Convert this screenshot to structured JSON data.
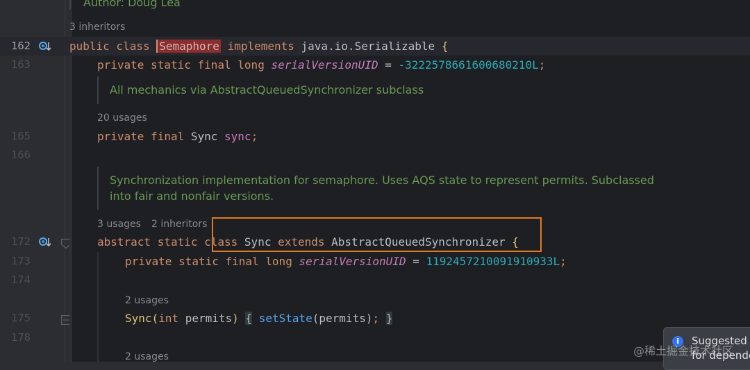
{
  "author_line": "Author: Doug Lea",
  "hints": {
    "class_inheritors": "3 inheritors",
    "sync_field_usages": "20 usages",
    "sync_class_usages": "3 usages",
    "sync_class_inheritors": "2 inheritors",
    "ctor_usages": "2 usages",
    "last_usages": "2 usages"
  },
  "line_numbers": [
    "162",
    "163",
    "165",
    "166",
    "172",
    "173",
    "174",
    "175",
    "178"
  ],
  "code": {
    "l162": {
      "kw1": "public class ",
      "cls": "Semaphore",
      "kw2": " implements ",
      "rest": "java.io.Serializable ",
      "brace": "{"
    },
    "l163": {
      "kw": "private static final long ",
      "field": "serialVersionUID",
      "eq": " = ",
      "num": "-3222578661600680210L",
      "semi": ";"
    },
    "doc1": "All mechanics via AbstractQueuedSynchronizer subclass",
    "l165": {
      "kw": "private final ",
      "type": "Sync ",
      "field": "sync",
      "semi": ";"
    },
    "doc2_line1": "Synchronization implementation for semaphore. Uses AQS state to represent permits. Subclassed",
    "doc2_line2": "into fair and nonfair versions.",
    "l172": {
      "kw1": "abstract static ",
      "kw2": "class ",
      "name": "Sync ",
      "kw3": "extends ",
      "parent": "AbstractQueuedSynchronizer ",
      "brace": "{"
    },
    "l173": {
      "kw": "private static final long ",
      "field": "serialVersionUID",
      "eq": " = ",
      "num": "1192457210091910933L",
      "semi": ";"
    },
    "l175": {
      "fn": "Sync",
      "open": "(",
      "kw": "int ",
      "param": "permits",
      "close": ")",
      "sp": " ",
      "b1": "{",
      "call": " setState",
      "args": "(permits)",
      "semi": ";",
      "sp2": " ",
      "b2": "}"
    }
  },
  "toast": {
    "icon": "info-icon",
    "title": "Suggested",
    "body": "for depende"
  },
  "watermark": "@稀土掘金技术社区",
  "colors": {
    "keyword": "#cf8e6d",
    "field": "#c77dbb",
    "number": "#2aacb8",
    "doc": "#6a9955",
    "highlight_box": "#e07b22"
  }
}
